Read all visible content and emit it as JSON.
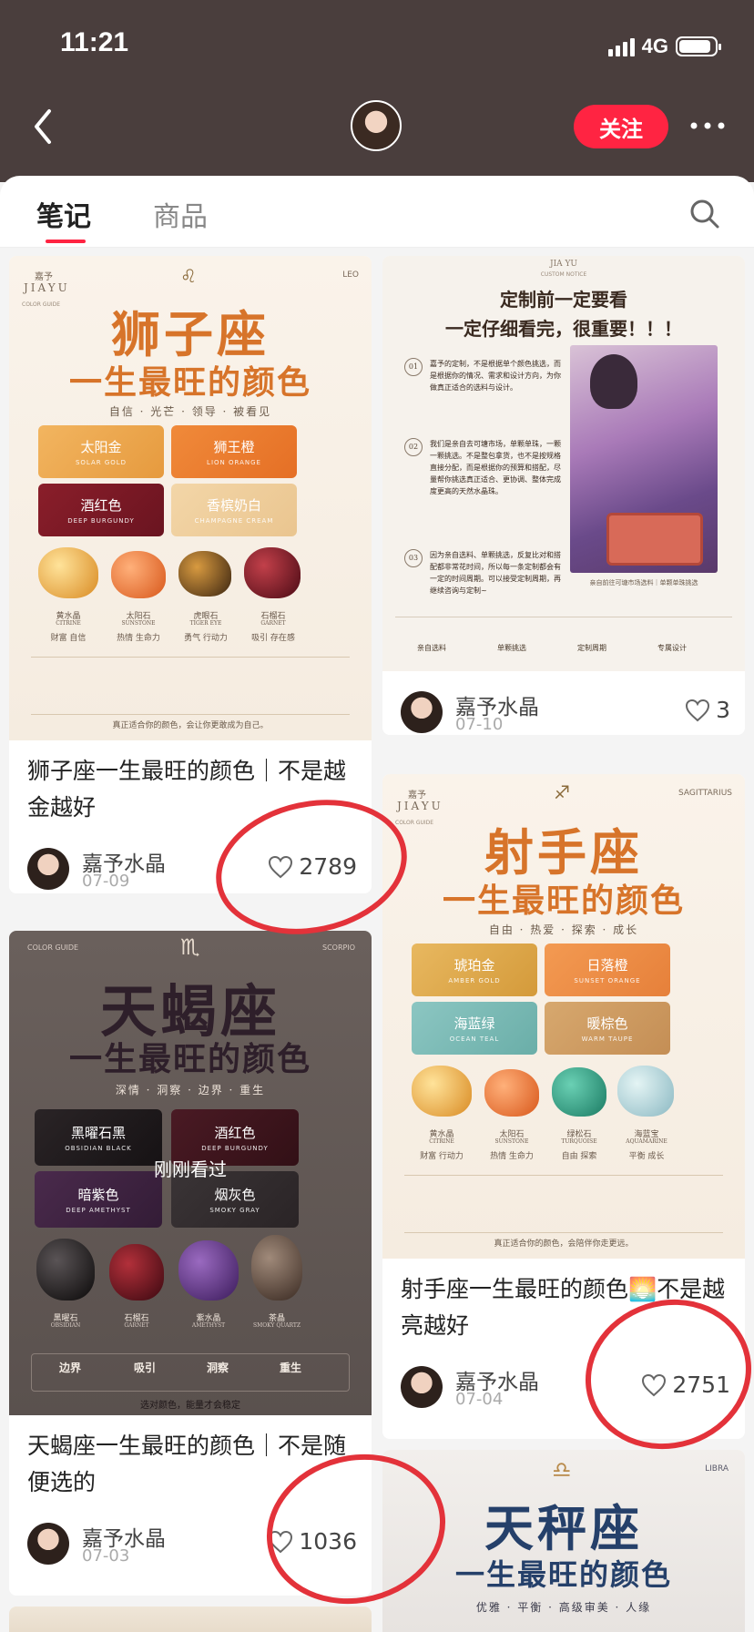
{
  "status": {
    "time": "11:21",
    "network": "4G"
  },
  "header": {
    "follow_label": "关注"
  },
  "tabs": [
    {
      "label": "笔记"
    },
    {
      "label": "商品"
    }
  ],
  "colors": {
    "accent": "#ff2442",
    "topbar": "#4a3e3d",
    "annotation": "#e3323a"
  },
  "notes": [
    {
      "title": "狮子座一生最旺的颜色｜不是越金越好",
      "author": "嘉予水晶",
      "date": "07-09",
      "likes": "2789",
      "cover": {
        "brand_cn": "嘉予",
        "brand_en": "JIAYU",
        "guide": "COLOR GUIDE",
        "symbol": "♌",
        "sign_en": "LEO",
        "heading": "狮子座",
        "subheading": "一生最旺的颜色",
        "keywords": "自信 · 光芒 · 领导 · 被看见",
        "swatches": [
          {
            "cn": "太阳金",
            "en": "SOLAR GOLD"
          },
          {
            "cn": "狮王橙",
            "en": "LION ORANGE"
          },
          {
            "cn": "酒红色",
            "en": "DEEP BURGUNDY"
          },
          {
            "cn": "香槟奶白",
            "en": "CHAMPAGNE CREAM"
          }
        ],
        "stones": [
          {
            "cn": "黄水晶",
            "en": "CITRINE",
            "note": "财富 自信"
          },
          {
            "cn": "太阳石",
            "en": "SUNSTONE",
            "note": "热情 生命力"
          },
          {
            "cn": "虎眼石",
            "en": "TIGER EYE",
            "note": "勇气 行动力"
          },
          {
            "cn": "石榴石",
            "en": "GARNET",
            "note": "吸引 存在感"
          }
        ],
        "footer": "真正适合你的颜色，会让你更敢成为自己。"
      }
    },
    {
      "title": "",
      "author": "嘉予水晶",
      "date": "07-10",
      "likes": "3",
      "cover": {
        "brand_en": "JIA YU",
        "brand_sub": "CUSTOM NOTICE",
        "heading1": "定制前一定要看",
        "heading2": "一定仔细看完，很重要！！！",
        "steps": [
          {
            "num": "01",
            "text": "嘉予的定制，不是根据单个颜色挑选，而是根据你的情况、需求和设计方向，为你做真正适合的选料与设计。"
          },
          {
            "num": "02",
            "text": "我们是亲自去可塘市场，单颗单珠，一颗一颗挑选。不是整包拿货，也不是按规格直接分配，而是根据你的预算和搭配，尽量帮你挑选真正适合、更协调、整体完成度更高的天然水晶珠。"
          },
          {
            "num": "03",
            "text": "因为亲自选料、单颗挑选，反复比对和搭配都非常花时间，所以每一条定制都会有一定的时间周期。可以接受定制周期，再继续咨询与定制~"
          }
        ],
        "photo_caption": "亲自前往可塘市场选料｜单颗单珠挑选",
        "icons": [
          "亲自选料",
          "单颗挑选",
          "定制周期",
          "专属设计"
        ]
      }
    },
    {
      "title": "射手座一生最旺的颜色🌅不是越亮越好",
      "author": "嘉予水晶",
      "date": "07-04",
      "likes": "2751",
      "cover": {
        "brand_cn": "嘉予",
        "brand_en": "JIAYU",
        "guide": "COLOR GUIDE",
        "symbol": "♐",
        "sign_en": "SAGITTARIUS",
        "heading": "射手座",
        "subheading": "一生最旺的颜色",
        "keywords": "自由 · 热爱 · 探索 · 成长",
        "swatches": [
          {
            "cn": "琥珀金",
            "en": "AMBER GOLD"
          },
          {
            "cn": "日落橙",
            "en": "SUNSET ORANGE"
          },
          {
            "cn": "海蓝绿",
            "en": "OCEAN TEAL"
          },
          {
            "cn": "暖棕色",
            "en": "WARM TAUPE"
          }
        ],
        "stones": [
          {
            "cn": "黄水晶",
            "en": "CITRINE",
            "note": "财富 行动力"
          },
          {
            "cn": "太阳石",
            "en": "SUNSTONE",
            "note": "热情 生命力"
          },
          {
            "cn": "绿松石",
            "en": "TURQUOISE",
            "note": "自由 探索"
          },
          {
            "cn": "海蓝宝",
            "en": "AQUAMARINE",
            "note": "平衡 成长"
          }
        ],
        "footer": "真正适合你的颜色，会陪伴你走更远。"
      }
    },
    {
      "title": "天蝎座一生最旺的颜色｜不是随便选的",
      "author": "嘉予水晶",
      "date": "07-03",
      "likes": "1036",
      "cover": {
        "guide": "COLOR GUIDE",
        "symbol": "♏",
        "sign_en": "SCORPIO",
        "heading": "天蝎座",
        "subheading": "一生最旺的颜色",
        "keywords": "深情 · 洞察 · 边界 · 重生",
        "overlay": "刚刚看过",
        "swatches": [
          {
            "cn": "黑曜石黑",
            "en": "OBSIDIAN BLACK"
          },
          {
            "cn": "酒红色",
            "en": "DEEP BURGUNDY"
          },
          {
            "cn": "暗紫色",
            "en": "DEEP AMETHYST"
          },
          {
            "cn": "烟灰色",
            "en": "SMOKY GRAY"
          }
        ],
        "stones": [
          {
            "cn": "黑曜石",
            "en": "OBSIDIAN"
          },
          {
            "cn": "石榴石",
            "en": "GARNET"
          },
          {
            "cn": "紫水晶",
            "en": "AMETHYST"
          },
          {
            "cn": "茶晶",
            "en": "SMOKY QUARTZ"
          }
        ],
        "badges": [
          "边界",
          "吸引",
          "洞察",
          "重生"
        ],
        "footer": "选对颜色，能量才会稳定"
      }
    },
    {
      "title": "",
      "cover": {
        "symbol": "♎",
        "sign_en": "LIBRA",
        "heading": "天秤座",
        "subheading": "一生最旺的颜色",
        "keywords": "优雅 · 平衡 · 高级审美 · 人缘"
      }
    }
  ]
}
